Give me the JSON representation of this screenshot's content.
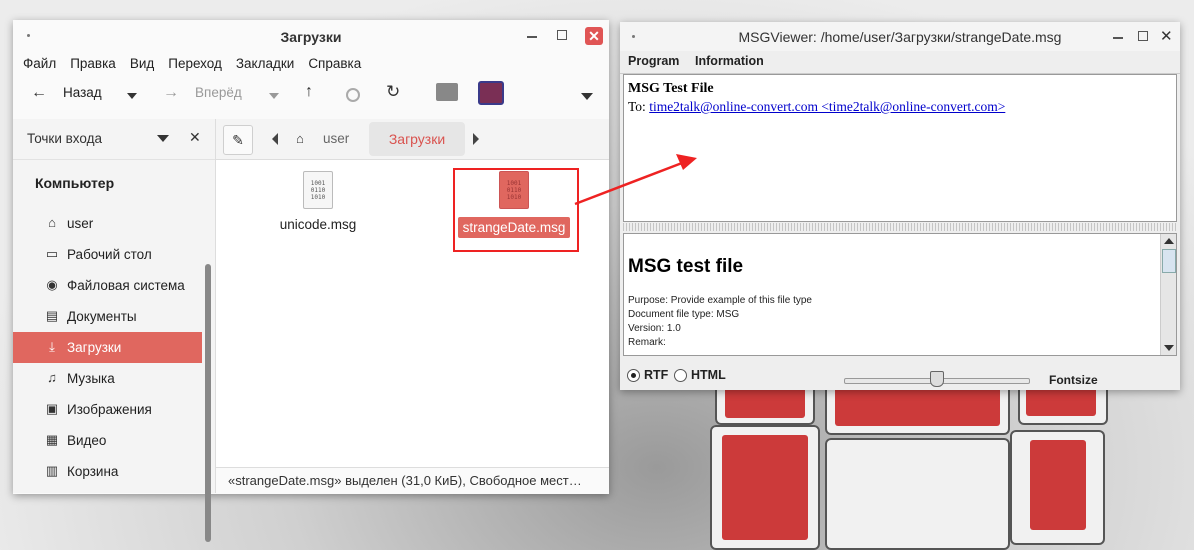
{
  "file_manager": {
    "title": "Загрузки",
    "menu": [
      "Файл",
      "Правка",
      "Вид",
      "Переход",
      "Закладки",
      "Справка"
    ],
    "toolbar": {
      "back_label": "Назад",
      "forward_label": "Вперёд"
    },
    "sidebar": {
      "header_label": "Точки входа",
      "section_title": "Компьютер",
      "items": [
        {
          "label": "user",
          "icon": "home-icon"
        },
        {
          "label": "Рабочий стол",
          "icon": "desktop-icon"
        },
        {
          "label": "Файловая система",
          "icon": "disk-icon"
        },
        {
          "label": "Документы",
          "icon": "documents-icon"
        },
        {
          "label": "Загрузки",
          "icon": "download-icon",
          "active": true
        },
        {
          "label": "Музыка",
          "icon": "music-icon"
        },
        {
          "label": "Изображения",
          "icon": "image-icon"
        },
        {
          "label": "Видео",
          "icon": "video-icon"
        },
        {
          "label": "Корзина",
          "icon": "trash-icon"
        }
      ]
    },
    "path": {
      "user": "user",
      "current": "Загрузки"
    },
    "files": [
      {
        "name": "unicode.msg",
        "selected": false
      },
      {
        "name": "strangeDate.msg",
        "selected": true
      }
    ],
    "status": "«strangeDate.msg» выделен (31,0 КиБ), Свободное мест…",
    "accent_color": "#e0675f"
  },
  "msg_viewer": {
    "title": "MSGViewer: /home/user/Загрузки/strangeDate.msg",
    "menu": [
      "Program",
      "Information"
    ],
    "header": {
      "subject": "MSG Test File",
      "to_label": "To:",
      "to_link": "time2talk@online-convert.com <time2talk@online-convert.com>"
    },
    "body": {
      "heading": "MSG test file",
      "lines": [
        "Purpose: Provide example of this file type",
        "Document file type: MSG",
        "Version: 1.0",
        "Remark:"
      ]
    },
    "footer": {
      "rtf_label": "RTF",
      "html_label": "HTML",
      "selected_format": "RTF",
      "fontsize_label": "Fontsize",
      "fontsize_value": 0.5
    }
  }
}
